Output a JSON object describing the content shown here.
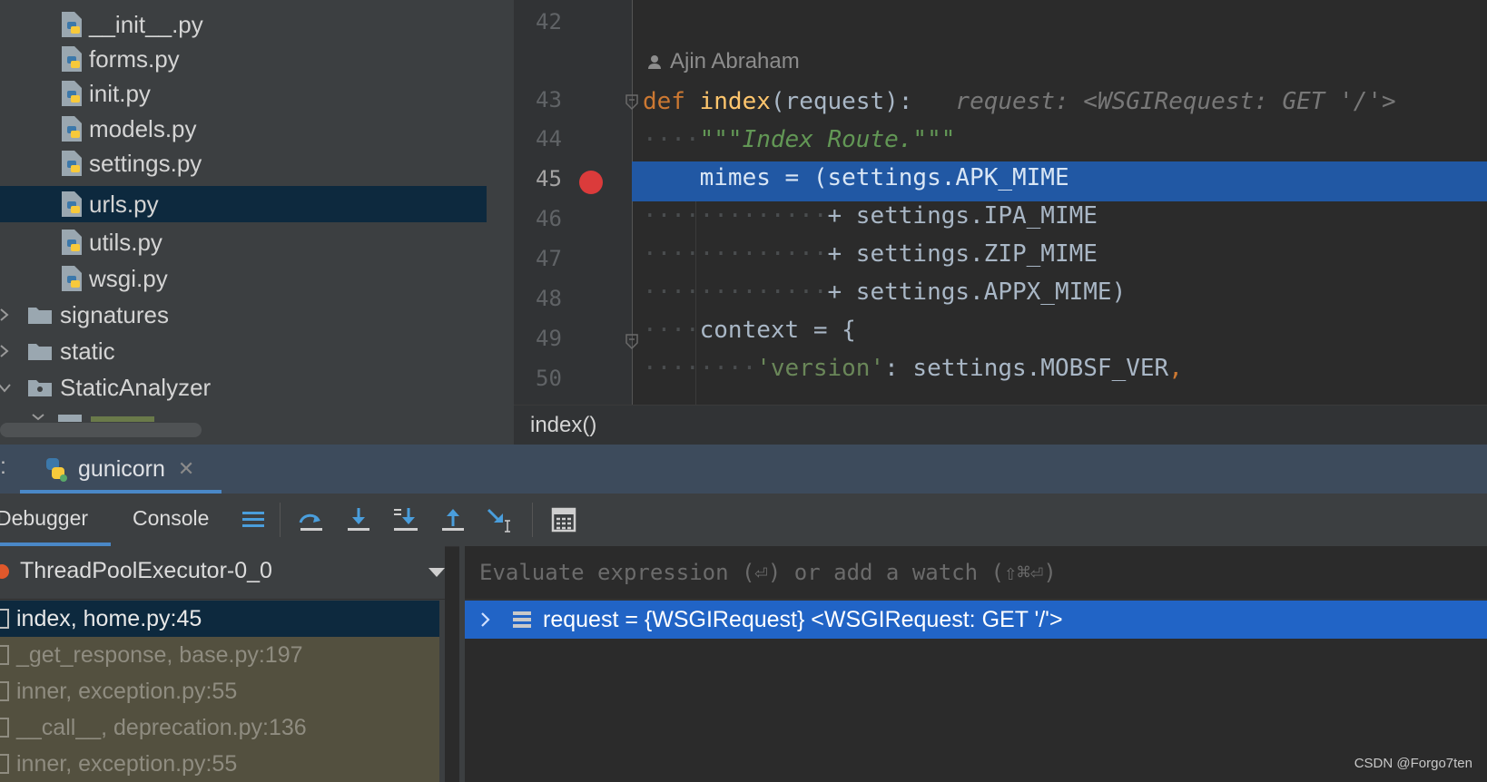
{
  "project_tree": {
    "files": [
      {
        "name": "__init__.py",
        "selected": false
      },
      {
        "name": "forms.py",
        "selected": false
      },
      {
        "name": "init.py",
        "selected": false
      },
      {
        "name": "models.py",
        "selected": false
      },
      {
        "name": "settings.py",
        "selected": false
      },
      {
        "name": "urls.py",
        "selected": true
      },
      {
        "name": "utils.py",
        "selected": false
      },
      {
        "name": "wsgi.py",
        "selected": false
      }
    ],
    "folders": [
      {
        "name": "signatures",
        "expanded": false
      },
      {
        "name": "static",
        "expanded": false
      },
      {
        "name": "StaticAnalyzer",
        "expanded": true
      }
    ]
  },
  "editor": {
    "author": "Ajin Abraham",
    "line_numbers": [
      "42",
      "43",
      "44",
      "45",
      "46",
      "47",
      "48",
      "49",
      "50"
    ],
    "current_line": "45",
    "code": {
      "l43_def": "def",
      "l43_name": "index",
      "l43_sig": "(request):",
      "l43_hint": "request: <WSGIRequest: GET '/'>",
      "l44_doc": "\"\"\"Index Route.\"\"\"",
      "l45": "mimes = (settings.APK_MIME",
      "l46": "+ settings.IPA_MIME",
      "l47": "+ settings.ZIP_MIME",
      "l48": "+ settings.APPX_MIME)",
      "l49": "context = {",
      "l50_key": "'version'",
      "l50_rest": ": settings.MOBSF_VER",
      "l50_comma": ","
    },
    "breadcrumb": "index()"
  },
  "debug": {
    "colon": ":",
    "run_tab": "gunicorn",
    "close_glyph": "✕",
    "tabs": {
      "debugger": "Debugger",
      "console": "Console"
    },
    "thread": "ThreadPoolExecutor-0_0",
    "frames": [
      {
        "label": "index, home.py:45",
        "kind": "selected"
      },
      {
        "label": "_get_response, base.py:197",
        "kind": "lib"
      },
      {
        "label": "inner, exception.py:55",
        "kind": "lib"
      },
      {
        "label": "__call__, deprecation.py:136",
        "kind": "lib"
      },
      {
        "label": "inner, exception.py:55",
        "kind": "lib"
      }
    ],
    "eval_placeholder": "Evaluate expression (⏎) or add a watch (⇧⌘⏎)",
    "variable": "request = {WSGIRequest} <WSGIRequest: GET '/'>"
  },
  "watermark": "CSDN @Forgo7ten",
  "colors": {
    "selection_blue": "#2158a4",
    "variable_blue": "#2164c6",
    "breakpoint_red": "#db3b3b",
    "tree_selected": "#0d293e"
  }
}
